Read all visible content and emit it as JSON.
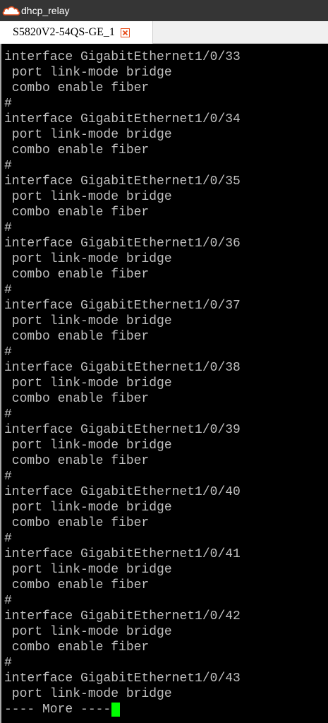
{
  "window": {
    "title": "dhcp_relay",
    "icon": "cloud-icon",
    "accent": "#e8501e"
  },
  "tabs": [
    {
      "label": "S5820V2-54QS-GE_1",
      "close_icon": "close-icon",
      "close_color": "#e8501e"
    }
  ],
  "terminal": {
    "lines": [
      "interface GigabitEthernet1/0/33",
      " port link-mode bridge",
      " combo enable fiber",
      "#",
      "interface GigabitEthernet1/0/34",
      " port link-mode bridge",
      " combo enable fiber",
      "#",
      "interface GigabitEthernet1/0/35",
      " port link-mode bridge",
      " combo enable fiber",
      "#",
      "interface GigabitEthernet1/0/36",
      " port link-mode bridge",
      " combo enable fiber",
      "#",
      "interface GigabitEthernet1/0/37",
      " port link-mode bridge",
      " combo enable fiber",
      "#",
      "interface GigabitEthernet1/0/38",
      " port link-mode bridge",
      " combo enable fiber",
      "#",
      "interface GigabitEthernet1/0/39",
      " port link-mode bridge",
      " combo enable fiber",
      "#",
      "interface GigabitEthernet1/0/40",
      " port link-mode bridge",
      " combo enable fiber",
      "#",
      "interface GigabitEthernet1/0/41",
      " port link-mode bridge",
      " combo enable fiber",
      "#",
      "interface GigabitEthernet1/0/42",
      " port link-mode bridge",
      " combo enable fiber",
      "#",
      "interface GigabitEthernet1/0/43",
      " port link-mode bridge"
    ],
    "more_prompt": "---- More ----",
    "text_color": "#c0c0c0",
    "background": "#000000",
    "cursor_color": "#00ff00"
  }
}
